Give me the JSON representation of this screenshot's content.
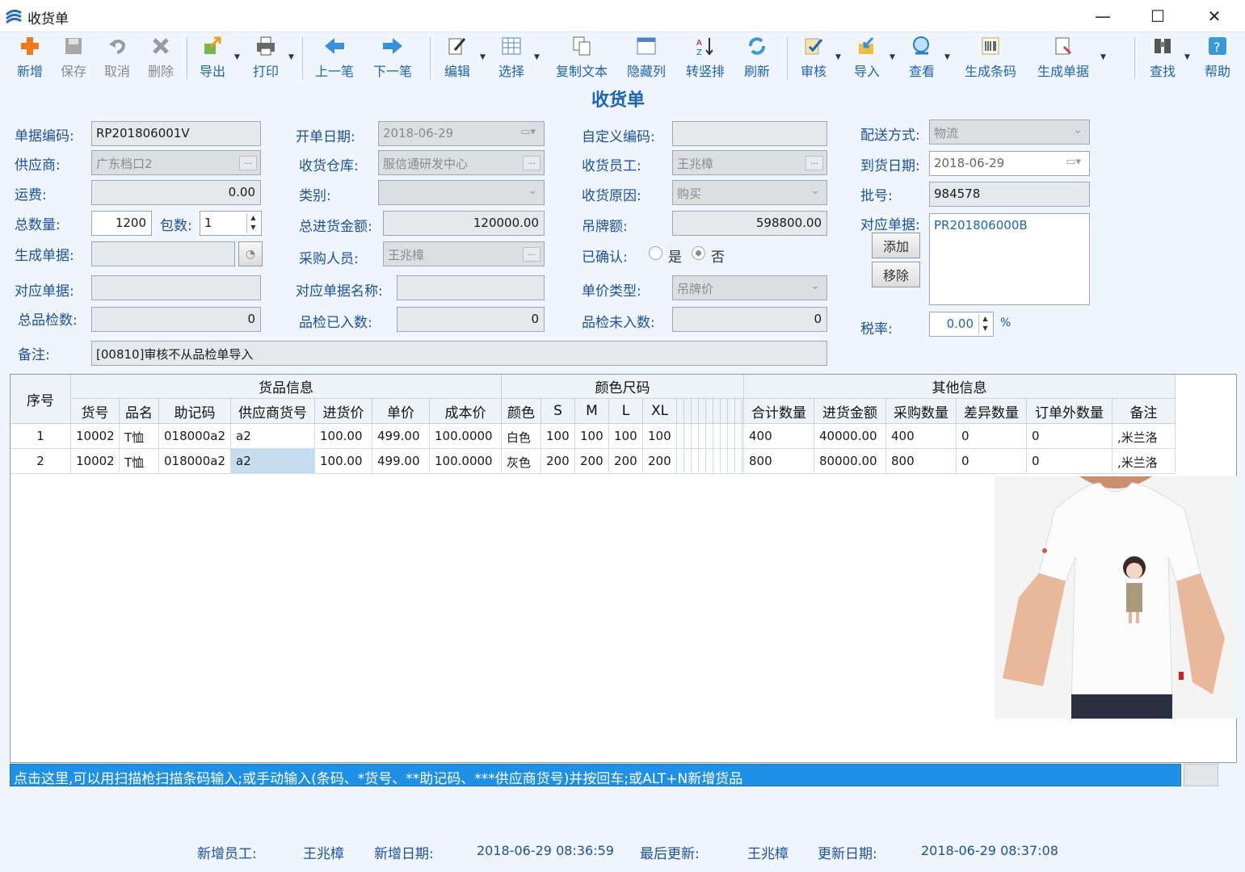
{
  "window": {
    "title": "收货单",
    "minimize": "—",
    "maximize": "☐",
    "close": "✕"
  },
  "toolbar": {
    "new": "新增",
    "save": "保存",
    "cancel": "取消",
    "delete": "删除",
    "export": "导出",
    "print": "打印",
    "prev": "上一笔",
    "next": "下一笔",
    "edit": "编辑",
    "select": "选择",
    "copy_text": "复制文本",
    "hide_col": "隐藏列",
    "transpose": "转竖排",
    "refresh": "刷新",
    "audit": "审核",
    "import": "导入",
    "view": "查看",
    "gen_barcode": "生成条码",
    "gen_doc": "生成单据",
    "find": "查找",
    "help": "帮助"
  },
  "page_title": "收货单",
  "form": {
    "doc_no_label": "单据编码:",
    "doc_no": "RP201806001V",
    "supplier_label": "供应商:",
    "supplier": "广东档口2",
    "freight_label": "运费:",
    "freight": "0.00",
    "total_qty_label": "总数量:",
    "total_qty": "1200",
    "packs_label": "包数:",
    "packs": "1",
    "gen_doc_label": "生成单据:",
    "gen_doc": "",
    "corr_doc_label": "对应单据:",
    "corr_doc": "",
    "total_qc_label": "总品检数:",
    "total_qc": "0",
    "remark_label": "备注:",
    "remark": "[00810]审核不从品检单导入",
    "open_date_label": "开单日期:",
    "open_date": "2018-06-29",
    "warehouse_label": "收货仓库:",
    "warehouse": "服信通研发中心",
    "category_label": "类别:",
    "category": "",
    "total_amount_label": "总进货金额:",
    "total_amount": "120000.00",
    "buyer_label": "采购人员:",
    "buyer": "王兆樟",
    "corr_doc_name_label": "对应单据名称:",
    "corr_doc_name": "",
    "qc_in_label": "品检已入数:",
    "qc_in": "0",
    "custom_code_label": "自定义编码:",
    "custom_code": "",
    "receiver_label": "收货员工:",
    "receiver": "王兆樟",
    "reason_label": "收货原因:",
    "reason": "购买",
    "tag_amount_label": "吊牌额:",
    "tag_amount": "598800.00",
    "confirmed_label": "已确认:",
    "confirmed_yes": "是",
    "confirmed_no": "否",
    "price_type_label": "单价类型:",
    "price_type": "吊牌价",
    "qc_not_in_label": "品检未入数:",
    "qc_not_in": "0",
    "delivery_label": "配送方式:",
    "delivery": "物流",
    "arrival_date_label": "到货日期:",
    "arrival_date": "2018-06-29",
    "batch_label": "批号:",
    "batch": "984578",
    "linked_docs_label": "对应单据:",
    "linked_doc": "PR201806000B",
    "add_btn": "添加",
    "remove_btn": "移除",
    "tax_label": "税率:",
    "tax": "0.00",
    "tax_unit": "%"
  },
  "grid": {
    "group_headers": [
      "货品信息",
      "颜色尺码",
      "其他信息"
    ],
    "seq_header": "序号",
    "columns": [
      "货号",
      "品名",
      "助记码",
      "供应商货号",
      "进货价",
      "单价",
      "成本价",
      "颜色",
      "S",
      "M",
      "L",
      "XL",
      "合计数量",
      "进货金额",
      "采购数量",
      "差异数量",
      "订单外数量",
      "备注"
    ],
    "rows": [
      [
        "1",
        "10002",
        "T恤",
        "018000a2",
        "a2",
        "100.00",
        "499.00",
        "100.0000",
        "白色",
        "100",
        "100",
        "100",
        "100",
        "400",
        "40000.00",
        "400",
        "0",
        "0",
        ",米兰洛"
      ],
      [
        "2",
        "10002",
        "T恤",
        "018000a2",
        "a2",
        "100.00",
        "499.00",
        "100.0000",
        "灰色",
        "200",
        "200",
        "200",
        "200",
        "800",
        "80000.00",
        "800",
        "0",
        "0",
        ",米兰洛"
      ]
    ]
  },
  "scan_hint": "点击这里,可以用扫描枪扫描条码输入;或手动输入(条码、*货号、**助记码、***供应商货号)并按回车;或ALT+N新增货品",
  "footer": {
    "creator_label": "新增员工:",
    "creator": "王兆樟",
    "create_date_label": "新增日期:",
    "create_date": "2018-06-29 08:36:59",
    "updater_label": "最后更新:",
    "updater": "王兆樟",
    "update_date_label": "更新日期:",
    "update_date": "2018-06-29 08:37:08"
  },
  "colors": {
    "accent": "#1e64b4",
    "scan_bar": "#1e90e6"
  }
}
